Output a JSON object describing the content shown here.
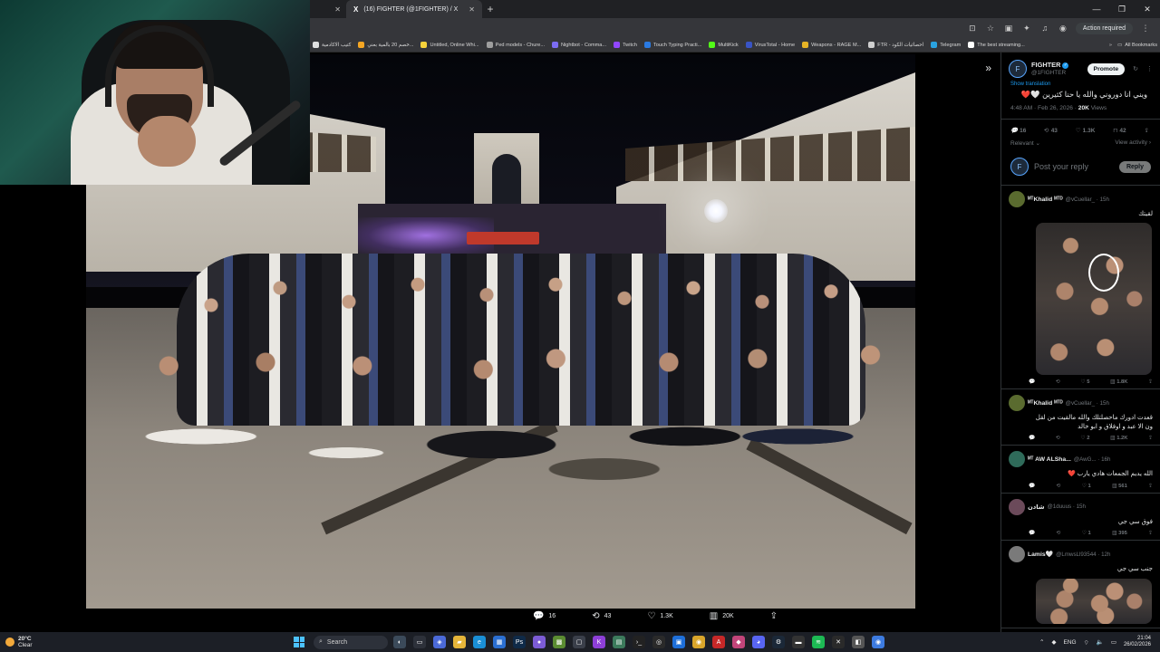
{
  "browser": {
    "prev_tab_close": "✕",
    "active_tab": {
      "title": "(16) FIGHTER (@1FIGHTER) / X",
      "favicon": "X",
      "close": "✕"
    },
    "new_tab": "+",
    "window_controls": [
      "—",
      "❐",
      "✕"
    ],
    "action_required": "Action required",
    "bookmarks": [
      {
        "label": "كتيب الاكادمية",
        "color": "#e0e0e0"
      },
      {
        "label": "خصم 20 بالمية بعني...",
        "color": "#f5a623"
      },
      {
        "label": "Untitled, Online Whi...",
        "color": "#f7d33b"
      },
      {
        "label": "Ped models - Chure...",
        "color": "#9e9e9e"
      },
      {
        "label": "Nightbot - Comma...",
        "color": "#7c6cf2"
      },
      {
        "label": "Twitch",
        "color": "#9146ff"
      },
      {
        "label": "Touch Typing Practi...",
        "color": "#2a7ae2"
      },
      {
        "label": "MultiKick",
        "color": "#53fc18"
      },
      {
        "label": "VirusTotal - Home",
        "color": "#3954c5"
      },
      {
        "label": "Weapons - RAGE M...",
        "color": "#e6b325"
      },
      {
        "label": "FTR - احصائيات الكود",
        "color": "#cfcfcf"
      },
      {
        "label": "Telegram",
        "color": "#2aa3e0"
      },
      {
        "label": "The best streaming...",
        "color": "#ffffff"
      }
    ],
    "bookmarks_more": "»",
    "all_bookmarks": "All Bookmarks"
  },
  "viewer": {
    "collapse_icon": "»",
    "engagement": {
      "replies": "16",
      "reposts": "43",
      "likes": "1.3K",
      "views": "20K"
    }
  },
  "post": {
    "author_name": "FIGHTER",
    "author_handle": "@1FIGHTER",
    "avatar_glyph": "F",
    "promote_label": "Promote",
    "show_translation": "Show translation",
    "text": "ويني انا دوروني والله يا حنا كثيرين 🤍❤️",
    "time": "4:48 AM · Feb 26, 2026 · ",
    "views_count": "20K",
    "views_label": " Views",
    "stats": {
      "replies": "16",
      "reposts": "43",
      "likes": "1.3K",
      "bookmarks": "42"
    },
    "relevant_label": "Relevant ⌄",
    "view_activity": "View activity ›",
    "reply_placeholder": "Post your reply",
    "reply_button": "Reply"
  },
  "replies": [
    {
      "name": "ᴹᵀKhalid ᴹᵀᴰ",
      "handle": "@vCuellar_ · 15h",
      "text": "لقيتك",
      "stats": {
        "likes": "5",
        "views": "1.8K"
      },
      "has_image": true,
      "avatar_color": "#5a6b2f"
    },
    {
      "name": "ᴹᵀKhalid ᴹᵀᴰ",
      "handle": "@vCuellar_ · 15h",
      "text": "قعدت ادورك ماحصلتلك والله مالقيت من لقل ون الا عبد و اوفلاق و ابو خالد",
      "stats": {
        "likes": "2",
        "views": "1.2K"
      },
      "has_image": false,
      "avatar_color": "#5a6b2f"
    },
    {
      "name": "ᴹᵀ AW ALSha...",
      "handle": "@AwG... · 16h",
      "text": "الله يديم الجمعات هادي يارب ❤️",
      "stats": {
        "likes": "1",
        "views": "561"
      },
      "has_image": false,
      "avatar_color": "#2f6b5a"
    },
    {
      "name": "شادن",
      "handle": "@1duuus · 15h",
      "text": "فوق سي جي",
      "stats": {
        "likes": "1",
        "views": "395"
      },
      "has_image": false,
      "avatar_color": "#6b4a5a"
    },
    {
      "name": "Lamis🤍",
      "handle": "@LmwsLl93544 · 12h",
      "text": "جنب سي جي",
      "stats": {
        "likes": "",
        "views": ""
      },
      "has_image": true,
      "avatar_color": "#7a7a7a"
    }
  ],
  "taskbar": {
    "temperature": "20°C",
    "condition": "Clear",
    "search_placeholder": "Search",
    "language": "ENG",
    "time": "21:04",
    "date": "26/02/2026"
  }
}
